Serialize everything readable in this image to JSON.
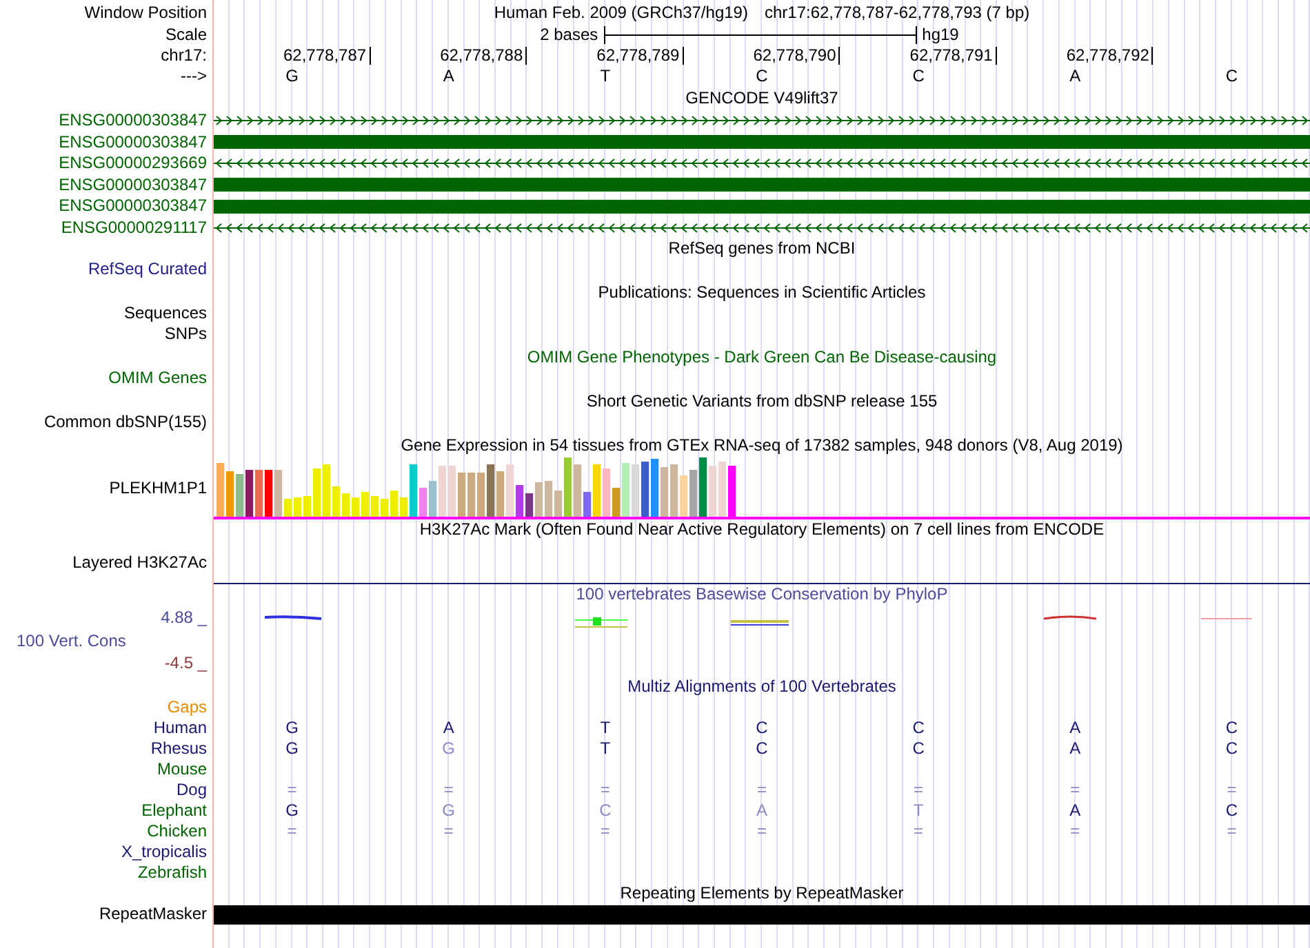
{
  "header": {
    "label": "Window Position",
    "assembly": "Human Feb. 2009 (GRCh37/hg19)",
    "position": "chr17:62,778,787-62,778,793 (7 bp)"
  },
  "scale": {
    "label": "Scale",
    "length": "2 bases",
    "assembly": "hg19"
  },
  "ruler": {
    "label": "chr17:",
    "positions": [
      "62,778,787",
      "62,778,788",
      "62,778,789",
      "62,778,790",
      "62,778,791",
      "62,778,792"
    ]
  },
  "bases": {
    "label": "--->",
    "letters": [
      "G",
      "A",
      "T",
      "C",
      "C",
      "A",
      "C"
    ]
  },
  "tracks": [
    {
      "kind": "genes",
      "title": {
        "text": "GENCODE V49lift37",
        "color": "#000000"
      },
      "genes": [
        {
          "name": "ENSG00000303847",
          "kind": "forward"
        },
        {
          "name": "ENSG00000303847",
          "kind": "block"
        },
        {
          "name": "ENSG00000293669",
          "kind": "reverse"
        },
        {
          "name": "ENSG00000303847",
          "kind": "block"
        },
        {
          "name": "ENSG00000303847",
          "kind": "block"
        },
        {
          "name": "ENSG00000291117",
          "kind": "reverse"
        }
      ]
    },
    {
      "kind": "labels",
      "title": {
        "text": "RefSeq genes from NCBI",
        "color": "#000000"
      },
      "rows": [
        {
          "label": "RefSeq Curated",
          "color": "#1e1e8c"
        }
      ]
    },
    {
      "kind": "labels",
      "title": {
        "text": "Publications: Sequences in Scientific Articles",
        "color": "#000000"
      },
      "rows": [
        {
          "label": "Sequences",
          "color": "#000000"
        },
        {
          "label": "SNPs",
          "color": "#000000"
        }
      ]
    },
    {
      "kind": "labels",
      "title": {
        "text": "OMIM Gene Phenotypes - Dark Green Can Be Disease-causing",
        "color": "#006400"
      },
      "rows": [
        {
          "label": "OMIM Genes",
          "color": "#006400"
        }
      ]
    },
    {
      "kind": "labels",
      "title": {
        "text": "Short Genetic Variants from dbSNP release 155",
        "color": "#000000"
      },
      "rows": [
        {
          "label": "Common dbSNP(155)",
          "color": "#000000"
        }
      ]
    },
    {
      "kind": "expression",
      "title": {
        "text": "Gene Expression in 54 tissues from GTEx RNA-seq of 17382 samples, 948 donors (V8, Aug 2019)",
        "color": "#000000"
      },
      "label": "PLEKHM1P1"
    },
    {
      "kind": "mark",
      "title": {
        "text": "H3K27Ac Mark (Often Found Near Active Regulatory Elements) on 7 cell lines from ENCODE",
        "color": "#000000"
      },
      "label": "Layered H3K27Ac"
    },
    {
      "kind": "wiggle",
      "title": {
        "text": "100 vertebrates Basewise Conservation by PhyloP",
        "color": "#4b4b9b"
      },
      "label": "100 Vert. Cons",
      "max": "4.88 _",
      "min": "-4.5 _"
    },
    {
      "kind": "alignment",
      "title": {
        "text": "Multiz Alignments of 100 Vertebrates",
        "color": "#191970"
      },
      "rows": [
        {
          "label": "Gaps",
          "color": "#e88a00"
        },
        {
          "label": "Human",
          "color": "#191970",
          "bases": [
            {
              "base": "G",
              "dimmed": false
            },
            {
              "base": "A",
              "dimmed": false
            },
            {
              "base": "T",
              "dimmed": false
            },
            {
              "base": "C",
              "dimmed": false
            },
            {
              "base": "C",
              "dimmed": false
            },
            {
              "base": "A",
              "dimmed": false
            },
            {
              "base": "C",
              "dimmed": false
            }
          ]
        },
        {
          "label": "Rhesus",
          "color": "#191970",
          "bases": [
            {
              "base": "G",
              "dimmed": false
            },
            {
              "base": "G",
              "dimmed": true
            },
            {
              "base": "T",
              "dimmed": false
            },
            {
              "base": "C",
              "dimmed": false
            },
            {
              "base": "C",
              "dimmed": false
            },
            {
              "base": "A",
              "dimmed": false
            },
            {
              "base": "C",
              "dimmed": false
            }
          ]
        },
        {
          "label": "Mouse",
          "color": "#006400"
        },
        {
          "label": "Dog",
          "color": "#191970",
          "bases": [
            {
              "base": "=",
              "dimmed": true
            },
            {
              "base": "=",
              "dimmed": true
            },
            {
              "base": "=",
              "dimmed": true
            },
            {
              "base": "=",
              "dimmed": true
            },
            {
              "base": "=",
              "dimmed": true
            },
            {
              "base": "=",
              "dimmed": true
            },
            {
              "base": "=",
              "dimmed": true
            }
          ]
        },
        {
          "label": "Elephant",
          "color": "#006400",
          "bases": [
            {
              "base": "G",
              "dimmed": false
            },
            {
              "base": "G",
              "dimmed": true
            },
            {
              "base": "C",
              "dimmed": true
            },
            {
              "base": "A",
              "dimmed": true
            },
            {
              "base": "T",
              "dimmed": true
            },
            {
              "base": "A",
              "dimmed": false
            },
            {
              "base": "C",
              "dimmed": false
            }
          ]
        },
        {
          "label": "Chicken",
          "color": "#006400",
          "bases": [
            {
              "base": "=",
              "dimmed": true
            },
            {
              "base": "=",
              "dimmed": true
            },
            {
              "base": "=",
              "dimmed": true
            },
            {
              "base": "=",
              "dimmed": true
            },
            {
              "base": "=",
              "dimmed": true
            },
            {
              "base": "=",
              "dimmed": true
            },
            {
              "base": "=",
              "dimmed": true
            }
          ]
        },
        {
          "label": "X_tropicalis",
          "color": "#191970"
        },
        {
          "label": "Zebrafish",
          "color": "#006400"
        }
      ]
    },
    {
      "kind": "repeats",
      "title": {
        "text": "Repeating Elements by RepeatMasker",
        "color": "#000000"
      },
      "label": "RepeatMasker"
    }
  ]
}
